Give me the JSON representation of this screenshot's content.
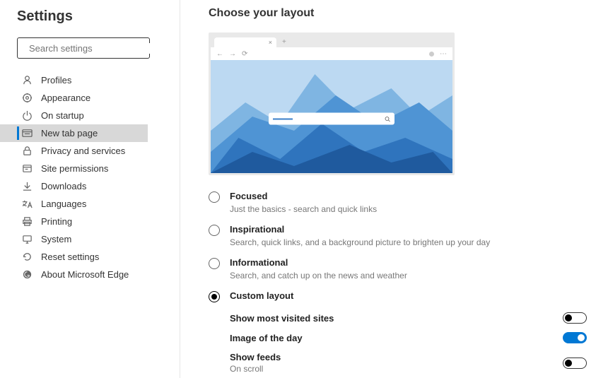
{
  "sidebar": {
    "title": "Settings",
    "search_placeholder": "Search settings",
    "items": [
      {
        "label": "Profiles",
        "icon": "profile"
      },
      {
        "label": "Appearance",
        "icon": "appearance"
      },
      {
        "label": "On startup",
        "icon": "power"
      },
      {
        "label": "New tab page",
        "icon": "newtab",
        "active": true
      },
      {
        "label": "Privacy and services",
        "icon": "lock"
      },
      {
        "label": "Site permissions",
        "icon": "site"
      },
      {
        "label": "Downloads",
        "icon": "download"
      },
      {
        "label": "Languages",
        "icon": "language"
      },
      {
        "label": "Printing",
        "icon": "printer"
      },
      {
        "label": "System",
        "icon": "system"
      },
      {
        "label": "Reset settings",
        "icon": "reset"
      },
      {
        "label": "About Microsoft Edge",
        "icon": "edge"
      }
    ]
  },
  "main": {
    "title": "Choose your layout",
    "options": [
      {
        "label": "Focused",
        "desc": "Just the basics - search and quick links",
        "checked": false
      },
      {
        "label": "Inspirational",
        "desc": "Search, quick links, and a background picture to brighten up your day",
        "checked": false
      },
      {
        "label": "Informational",
        "desc": "Search, and catch up on the news and weather",
        "checked": false
      },
      {
        "label": "Custom layout",
        "desc": "",
        "checked": true
      }
    ],
    "custom": [
      {
        "label": "Show most visited sites",
        "desc": "",
        "on": false
      },
      {
        "label": "Image of the day",
        "desc": "",
        "on": true
      },
      {
        "label": "Show feeds",
        "desc": "On scroll",
        "on": false
      }
    ]
  }
}
